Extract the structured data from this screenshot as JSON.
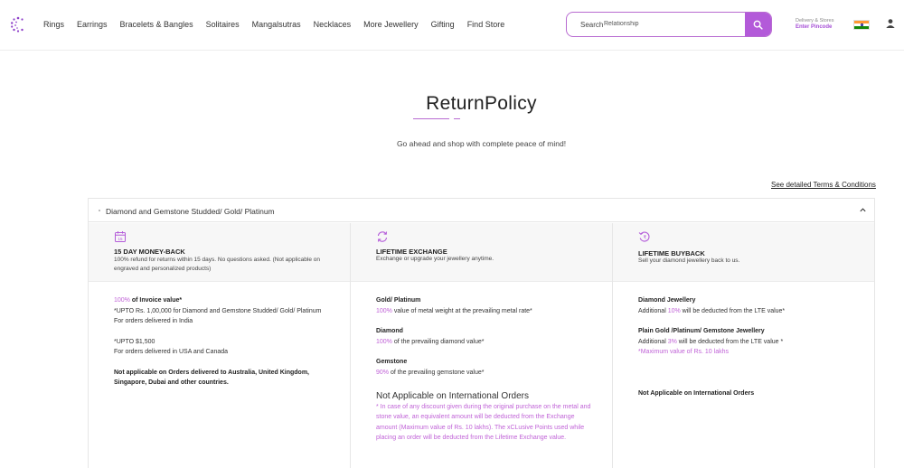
{
  "header": {
    "nav": [
      "Rings",
      "Earrings",
      "Bracelets & Bangles",
      "Solitaires",
      "Mangalsutras",
      "Necklaces",
      "More Jewellery",
      "Gifting",
      "Find Store"
    ],
    "search_label": "Search",
    "search_value": "Relationship",
    "delivery_label": "Delivery & Stores",
    "pincode_label": "Enter Pincode"
  },
  "page": {
    "title": "ReturnPolicy",
    "subtitle": "Go ahead and shop with complete peace of mind!",
    "terms_link": "See detailed Terms & Conditions"
  },
  "accordion": {
    "label": "Diamond and Gemstone Studded/ Gold/ Platinum",
    "columns": [
      {
        "heading": "15 DAY MONEY-BACK",
        "desc": "100% refund for returns within 15 days. No questions asked. (Not applicable on engraved and personalized products)",
        "body": {
          "pct": "100%",
          "pct_rest": " of Invoice value*",
          "l1": "*UPTO Rs. 1,00,000 for Diamond and Gemstone Studded/ Gold/ Platinum",
          "l2": "For orders delivered in India",
          "l3": "*UPTO $1,500",
          "l4": "For orders delivered in USA and Canada",
          "note": "Not applicable on Orders delivered to Australia, United Kingdom, Singapore, Dubai and other countries."
        }
      },
      {
        "heading": "LIFETIME EXCHANGE",
        "desc": "Exchange or upgrade your jewellery anytime.",
        "body": {
          "g_title": "Gold/ Platinum",
          "g_pct": "100%",
          "g_rest": " value of metal weight at the prevailing metal rate*",
          "d_title": "Diamond",
          "d_pct": "100%",
          "d_rest": " of the prevailing diamond value*",
          "s_title": "Gemstone",
          "s_pct": "90%",
          "s_rest": " of the prevailing gemstone value*",
          "intl_title": "Not Applicable on International Orders",
          "intl_note": "* In case of any discount given during the original purchase on the metal and stone value, an equivalent amount will be deducted from the Exchange amount (Maximum value of Rs. 10 lakhs). The xCLusive Points used while placing an order will be deducted from the Lifetime Exchange value."
        }
      },
      {
        "heading": "LIFETIME BUYBACK",
        "desc": "Sell your diamond jewellery back to us.",
        "body": {
          "d_title": "Diamond Jewellery",
          "d_pre": "Additional ",
          "d_pct": "10%",
          "d_rest": " will be deducted from the LTE value*",
          "p_title": "Plain Gold /Platinum/ Gemstone Jewellery",
          "p_pre": "Additional ",
          "p_pct": "3%",
          "p_rest": " will be deducted from the LTE value *",
          "p_note": "*Maximum value of Rs. 10 lakhs",
          "intl": "Not Applicable on International Orders"
        }
      }
    ]
  },
  "colors": {
    "accent": "#b35ad9",
    "accent_text": "#a64fd6"
  },
  "icons": [
    "logo-icon",
    "search-icon",
    "india-flag-icon",
    "user-icon",
    "chevron-up-icon",
    "calendar-icon",
    "exchange-icon",
    "buyback-icon"
  ]
}
